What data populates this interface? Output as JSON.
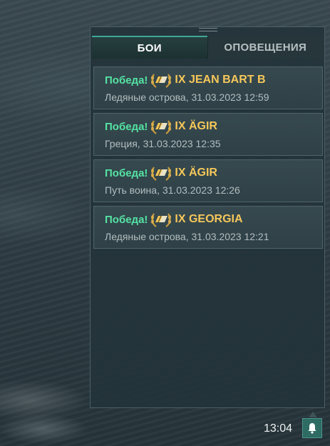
{
  "panel": {
    "tabs": [
      {
        "label": "БОИ",
        "active": true
      },
      {
        "label": "ОПОВЕЩЕНИЯ",
        "active": false
      }
    ],
    "battles": [
      {
        "result": "Победа!",
        "ship": "IX JEAN BART B",
        "details": "Ледяные острова, 31.03.2023 12:59",
        "medal_icon": "laurel-wreath-icon"
      },
      {
        "result": "Победа!",
        "ship": "IX ÄGIR",
        "details": "Греция, 31.03.2023 12:35",
        "medal_icon": "laurel-wreath-icon"
      },
      {
        "result": "Победа!",
        "ship": "IX ÄGIR",
        "details": "Путь воина, 31.03.2023 12:26",
        "medal_icon": "laurel-wreath-icon"
      },
      {
        "result": "Победа!",
        "ship": "IX GEORGIA",
        "details": "Ледяные острова, 31.03.2023 12:21",
        "medal_icon": "laurel-wreath-icon"
      }
    ]
  },
  "taskbar": {
    "time": "13:04",
    "bell_icon": "bell-icon"
  },
  "colors": {
    "victory": "#55e3a3",
    "ship_name": "#f6c75a",
    "accent": "#3fa897"
  }
}
